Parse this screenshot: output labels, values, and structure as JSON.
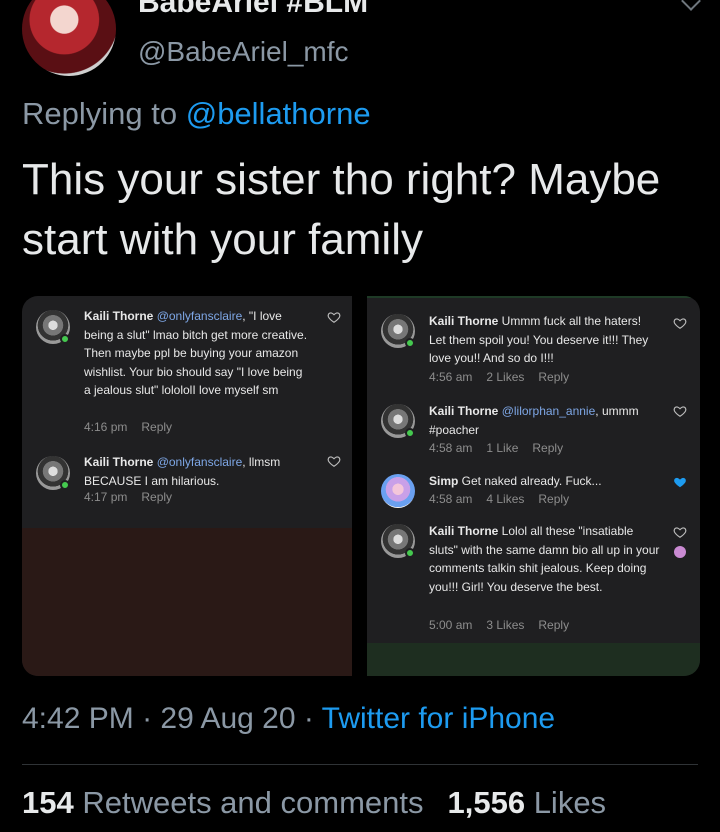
{
  "author": {
    "display_name": "BabeAriel #BLM",
    "handle": "@BabeAriel_mfc"
  },
  "reply": {
    "prefix": "Replying to ",
    "mention": "@bellathorne"
  },
  "tweet_text": "This your sister tho right? Maybe start with your family",
  "media": {
    "left_comments": [
      {
        "name": "Kaili Thorne",
        "mention": "@onlyfansclaire",
        "text": ", \"I love being a slut\" lmao bitch get more creative. Then maybe ppl be buying your amazon wishlist. Your bio should say \"I love being a jealous slut\" lolololI love myself sm",
        "time": "4:16 pm",
        "reply": "Reply"
      },
      {
        "name": "Kaili Thorne",
        "mention": "@onlyfansclaire",
        "text": ", llmsm BECAUSE I am hilarious.",
        "time": "4:17 pm",
        "reply": "Reply"
      }
    ],
    "right_comments": [
      {
        "name": "Kaili Thorne",
        "mention": "",
        "text": " Ummm fuck all the haters! Let them spoil you! You deserve it!!! They love you!! And so do I!!!",
        "time": "4:56 am",
        "likes": "2 Likes",
        "reply": "Reply"
      },
      {
        "name": "Kaili Thorne",
        "mention": "@lilorphan_annie",
        "text": ", ummm #poacher",
        "time": "4:58 am",
        "likes": "1 Like",
        "reply": "Reply"
      },
      {
        "name": "Simp",
        "mention": "",
        "text": " Get naked already. Fuck...",
        "time": "4:58 am",
        "likes": "4 Likes",
        "reply": "Reply"
      },
      {
        "name": "Kaili Thorne",
        "mention": "",
        "text": " Lolol all these \"insatiable sluts\" with the same damn bio all up in your comments talkin shit jealous. Keep doing you!!! Girl! You deserve the best.",
        "time": "5:00 am",
        "likes": "3 Likes",
        "reply": "Reply"
      }
    ]
  },
  "footer": {
    "time": "4:42 PM",
    "sep1": " · ",
    "date": "29 Aug 20",
    "sep2": " · ",
    "source": "Twitter for iPhone"
  },
  "stats": {
    "retweets_count": "154",
    "retweets_label": " Retweets and comments",
    "likes_count": "1,556",
    "likes_label": " Likes"
  },
  "colors": {
    "accent": "#1d9bf0",
    "muted": "#8b98a5",
    "liked_heart": "#1d9bf0"
  }
}
